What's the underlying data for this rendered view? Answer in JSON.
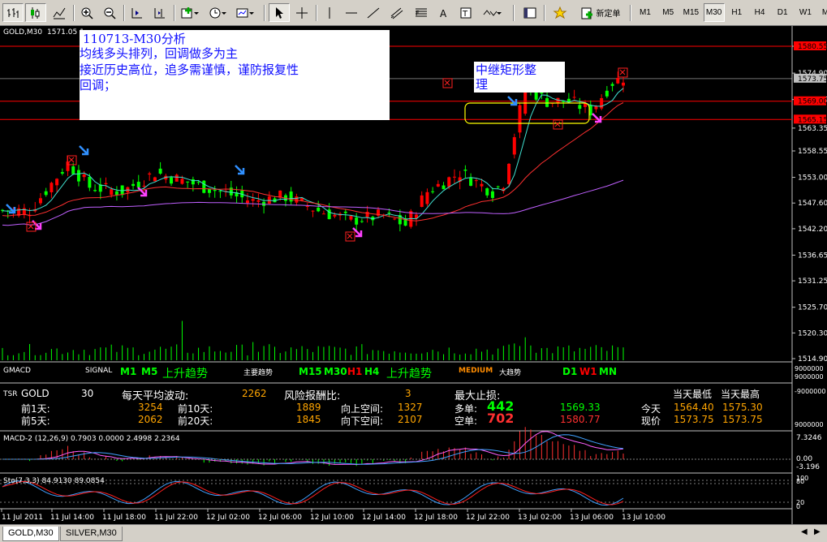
{
  "toolbar": {
    "new_order": "新定单",
    "periods": [
      "M1",
      "M5",
      "M15",
      "M30",
      "H1",
      "H4",
      "D1",
      "W1",
      "MN"
    ],
    "active_period": "M30"
  },
  "chart": {
    "symbol_label": "GOLD,M30",
    "price_label": "1571.05 1",
    "price_axis": [
      "1580.55",
      "1574.90",
      "1569.35",
      "1563.35",
      "1558.55",
      "1553.00",
      "1547.60",
      "1542.20",
      "1536.65",
      "1531.25",
      "1525.70",
      "1520.30",
      "1514.90"
    ],
    "price_tags": [
      {
        "label": "1580.55",
        "color": "#ff0000"
      },
      {
        "label": "1573.75",
        "color": "#c0c0c0"
      },
      {
        "label": "1569.00",
        "color": "#ff0000"
      },
      {
        "label": "1565.15",
        "color": "#ff0000"
      }
    ],
    "time_axis": [
      "11 Jul 2011",
      "11 Jul 14:00",
      "11 Jul 18:00",
      "11 Jul 22:00",
      "12 Jul 02:00",
      "12 Jul 06:00",
      "12 Jul 10:00",
      "12 Jul 14:00",
      "12 Jul 18:00",
      "12 Jul 22:00",
      "13 Jul 02:00",
      "13 Jul 06:00",
      "13 Jul 10:00"
    ],
    "analysis_note": {
      "title": "110713-M30分析",
      "line1": "均线多头排列，回调做多为主",
      "line2": "接近历史高位，追多需谨慎，谨防报复性",
      "line3": "回调；"
    },
    "consolidation_note": "中继矩形整\n理",
    "colors": {
      "bull": "#ff0000",
      "bear": "#00ff00",
      "ma_fast": "#40e0d0",
      "ma_mid": "#ff3030",
      "ma_slow": "#c060ff",
      "volume": "#00ff00"
    }
  },
  "gmacd": {
    "name": "GMACD",
    "signal_label": "SIGNAL",
    "m1": "M1",
    "m5": "M5",
    "trend1": "上升趋势",
    "main_trend_label": "主要趋势",
    "m15": "M15",
    "m30": "M30",
    "h1": "H1",
    "h4": "H4",
    "trend2": "上升趋势",
    "medium": "MEDIUM",
    "big_trend_label": "大趋势",
    "d1": "D1",
    "w1": "W1",
    "mn": "MN",
    "axis_top": "9000000",
    "axis_bottom": "9000000"
  },
  "tsr": {
    "name": "TSR",
    "symbol": "GOLD",
    "value": "30",
    "avg_label": "每天平均波动:",
    "avg_value": "2262",
    "risk_label": "风险报酬比:",
    "risk_value": "3",
    "max_label": "最大止损:",
    "today_low_label": "当天最低",
    "today_high_label": "当天最高",
    "r1_label": "前1天:",
    "r1_val": "3254",
    "r10_label": "前10天:",
    "r10_val": "1889",
    "up_label": "向上空间:",
    "up_val": "1327",
    "long_label": "多单:",
    "long_num": "442",
    "long_price": "1569.33",
    "today_label": "今天",
    "today_low": "1564.40",
    "today_high": "1575.30",
    "r5_label": "前5天:",
    "r5_val": "2062",
    "r20_label": "前20天:",
    "r20_val": "1845",
    "down_label": "向下空间:",
    "down_val": "2107",
    "short_label": "空单:",
    "short_num": "702",
    "short_price": "1580.77",
    "now_label": "现价",
    "now_low": "1573.75",
    "now_high": "1573.75",
    "axis_top": "-9000000",
    "axis_bottom": "9000000"
  },
  "macd": {
    "label": "MACD-2 (12,26,9) 0.7903 0.0000 2.4998 2.2364",
    "axis": [
      "7.3246",
      "0.00",
      "-3.196"
    ]
  },
  "sto": {
    "label": "Sto(7,3,3) 84.9130 89.0854",
    "axis": [
      "100",
      "80",
      "20",
      "0"
    ]
  },
  "tabs": [
    "GOLD,M30",
    "SILVER,M30"
  ]
}
